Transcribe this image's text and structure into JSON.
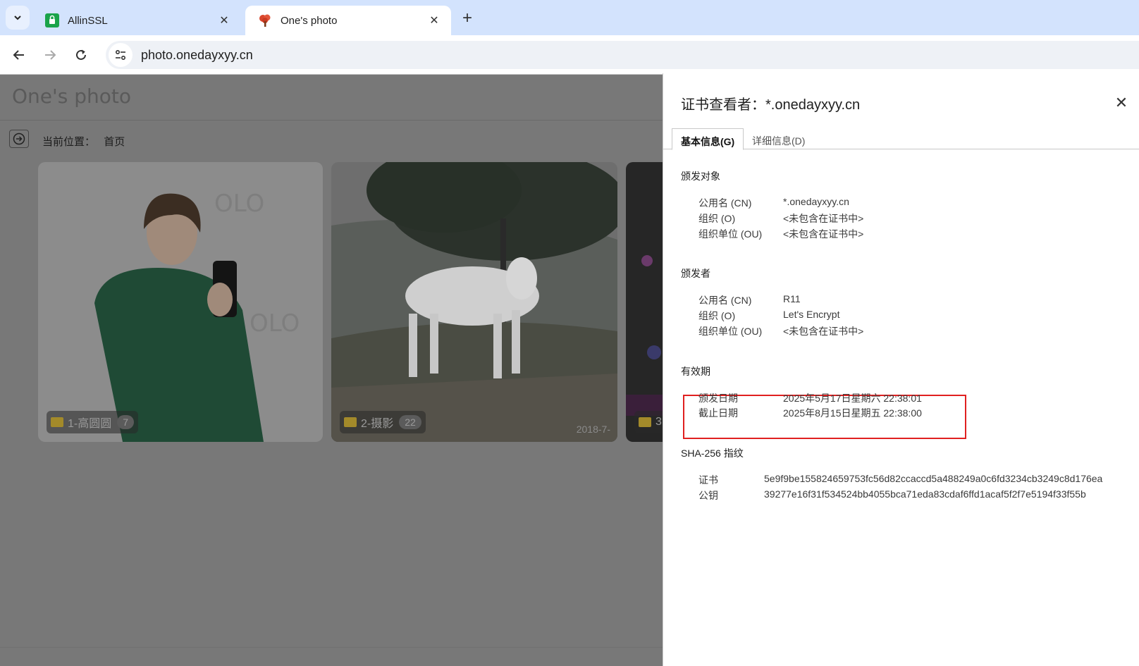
{
  "browser": {
    "tabs": [
      {
        "title": "AllinSSL",
        "active": false,
        "favicon": "allinssl-lock-icon"
      },
      {
        "title": "One's photo",
        "active": true,
        "favicon": "red-tree-icon"
      }
    ],
    "url": "photo.onedayxyy.cn"
  },
  "page": {
    "site_title": "One's photo",
    "breadcrumb_label": "当前位置：",
    "breadcrumb_current": "首页",
    "albums": [
      {
        "name": "1-高圆圆",
        "count": "7",
        "date": ""
      },
      {
        "name": "2-摄影",
        "count": "22",
        "date": "2018-7-"
      },
      {
        "name": "3",
        "count": "",
        "date": ""
      }
    ]
  },
  "cert_viewer": {
    "title": "证书查看者：*.onedayxyy.cn",
    "tabs": {
      "basic": "基本信息(G)",
      "details": "详细信息(D)"
    },
    "issued_to": {
      "heading": "颁发对象",
      "rows": [
        {
          "k": "公用名 (CN)",
          "v": "*.onedayxyy.cn"
        },
        {
          "k": "组织 (O)",
          "v": "<未包含在证书中>"
        },
        {
          "k": "组织单位 (OU)",
          "v": "<未包含在证书中>"
        }
      ]
    },
    "issued_by": {
      "heading": "颁发者",
      "rows": [
        {
          "k": "公用名 (CN)",
          "v": "R11"
        },
        {
          "k": "组织 (O)",
          "v": "Let's Encrypt"
        },
        {
          "k": "组织单位 (OU)",
          "v": "<未包含在证书中>"
        }
      ]
    },
    "validity": {
      "heading": "有效期",
      "rows": [
        {
          "k": "颁发日期",
          "v": "2025年5月17日星期六 22:38:01"
        },
        {
          "k": "截止日期",
          "v": "2025年8月15日星期五 22:38:00"
        }
      ],
      "highlight_color": "#e02020"
    },
    "fingerprints": {
      "heading": "SHA-256 指纹",
      "rows": [
        {
          "k": "证书",
          "v": "5e9f9be155824659753fc56d82ccaccd5a488249a0c6fd3234cb3249c8d176ea"
        },
        {
          "k": "公钥",
          "v": "39277e16f31f534524bb4055bca71eda83cdaf6ffd1acaf5f2f7e5194f33f55b"
        }
      ]
    }
  }
}
